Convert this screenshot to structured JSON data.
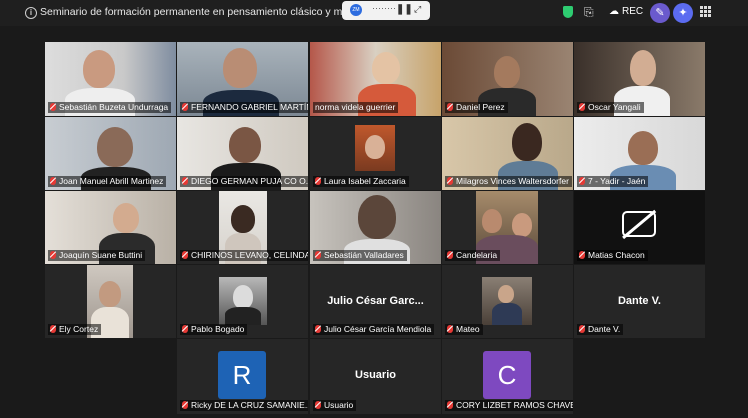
{
  "meeting": {
    "title": "Seminario de formación permanente en pensamiento clásico y medieval",
    "recording_label": "REC",
    "mini_toolbar": {
      "thumb_text": "ZM",
      "dots": "········",
      "pause": "❚❚",
      "expand": "⤢"
    }
  },
  "icons": {
    "info": "info-icon",
    "shield": "shield-icon",
    "share": "share-icon",
    "cloud": "cloud-icon",
    "wand": "wand-icon",
    "ai": "ai-sparkle-icon",
    "grid": "grid-icon",
    "mute": "mic-muted-icon",
    "camera_off": "camera-off-icon"
  },
  "colors": {
    "background": "#1a1a1a",
    "tile": "#262626",
    "active_speaker": "#3ddc84",
    "muted": "#e53935",
    "avatar_r": "#1e63b5",
    "avatar_c": "#7e49c0",
    "wand_button": "#6a5acd",
    "ai_button": "#5b6bf0"
  },
  "participants": [
    {
      "name": "Sebastián Buzeta Undurraga"
    },
    {
      "name": "FERNANDO GABRIEL MARTÍN D..."
    },
    {
      "name": "norma videla guerrier"
    },
    {
      "name": "Daniel Perez"
    },
    {
      "name": "Oscar Yangali"
    },
    {
      "name": "Joan Manuel Abrill Martinez"
    },
    {
      "name": "DIEGO GERMAN PUJA CO O..."
    },
    {
      "name": "Laura Isabel Zaccaria"
    },
    {
      "name": "Milagros Vinces Waltersdorfer"
    },
    {
      "name": "7 - Yadir - Jaén"
    },
    {
      "name": "Joaquín Suane Buttini"
    },
    {
      "name": "CHIRINOS LEVANO, CELINDA..."
    },
    {
      "name": "Sebastián Valladares"
    },
    {
      "name": "Candelaria"
    },
    {
      "name": "Matias Chacon"
    },
    {
      "name": "Ely Cortez"
    },
    {
      "name": "Pablo Bogado"
    },
    {
      "name": "Julio César García Mendiola",
      "display": "Julio César Garc..."
    },
    {
      "name": "Mateo"
    },
    {
      "name": "Dante V.",
      "display": "Dante V."
    },
    {
      "name": "Ricky DE LA CRUZ SAMANIE...",
      "avatar": "R"
    },
    {
      "name": "Usuario",
      "display": "Usuario"
    },
    {
      "name": "CORY LIZBET RAMOS CHAVEZ",
      "avatar": "C"
    }
  ]
}
